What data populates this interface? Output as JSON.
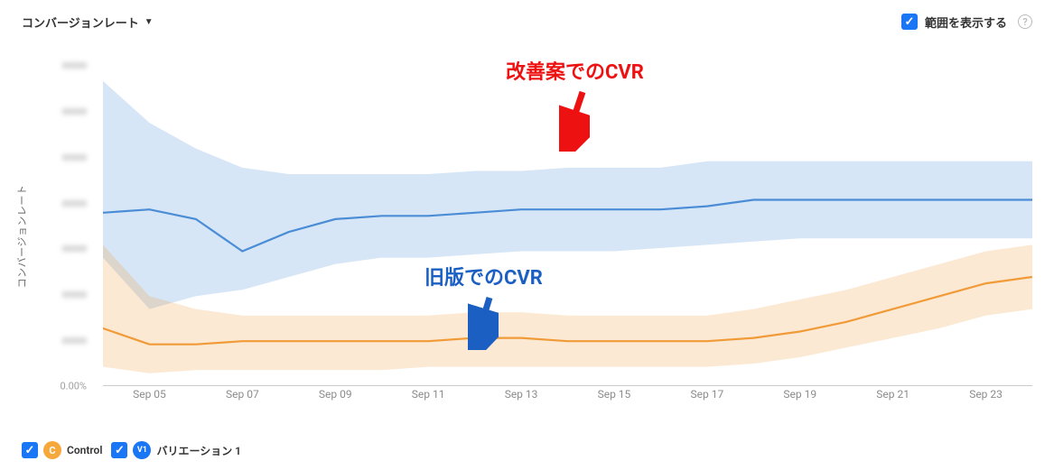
{
  "header": {
    "dropdown_label": "コンバージョンレート",
    "range_toggle_label": "範囲を表示する"
  },
  "y_axis": {
    "label": "コンバージョンレート",
    "ticks": [
      "xxxxx",
      "xxxxx",
      "xxxxx",
      "xxxxx",
      "xxxxx",
      "xxxxx",
      "xxxxx",
      "0.00%"
    ]
  },
  "x_axis": {
    "labels": [
      "Sep 05",
      "Sep 07",
      "Sep 09",
      "Sep 11",
      "Sep 13",
      "Sep 15",
      "Sep 17",
      "Sep 19",
      "Sep 21",
      "Sep 23"
    ]
  },
  "legend": {
    "control_badge": "C",
    "control_label": "Control",
    "variation_badge": "V1",
    "variation_label": "バリエーション 1"
  },
  "annotations": {
    "red_label": "改善案でのCVR",
    "blue_label": "旧版でのCVR"
  },
  "chart_data": {
    "type": "line",
    "title": "コンバージョンレート",
    "xlabel": "",
    "ylabel": "コンバージョンレート",
    "ylim": [
      0,
      100
    ],
    "x": [
      "Sep 04",
      "Sep 05",
      "Sep 06",
      "Sep 07",
      "Sep 08",
      "Sep 09",
      "Sep 10",
      "Sep 11",
      "Sep 12",
      "Sep 13",
      "Sep 14",
      "Sep 15",
      "Sep 16",
      "Sep 17",
      "Sep 18",
      "Sep 19",
      "Sep 20",
      "Sep 21",
      "Sep 22",
      "Sep 23",
      "Sep 24"
    ],
    "series": [
      {
        "name": "バリエーション 1",
        "color": "#4a8dd6",
        "values": [
          54,
          55,
          52,
          42,
          48,
          52,
          53,
          53,
          54,
          55,
          55,
          55,
          55,
          56,
          58,
          58,
          58,
          58,
          58,
          58,
          58
        ],
        "lower": [
          40,
          24,
          28,
          30,
          34,
          38,
          40,
          40,
          41,
          42,
          42,
          42,
          43,
          44,
          45,
          46,
          46,
          46,
          46,
          46,
          46
        ],
        "upper": [
          95,
          82,
          74,
          68,
          66,
          66,
          66,
          66,
          67,
          67,
          68,
          68,
          68,
          70,
          70,
          70,
          70,
          70,
          70,
          70,
          70
        ]
      },
      {
        "name": "Control",
        "color": "#f19b38",
        "values": [
          18,
          13,
          13,
          14,
          14,
          14,
          14,
          14,
          15,
          15,
          14,
          14,
          14,
          14,
          15,
          17,
          20,
          24,
          28,
          32,
          34
        ],
        "lower": [
          6,
          4,
          5,
          5,
          5,
          5,
          5,
          6,
          6,
          6,
          6,
          6,
          6,
          6,
          7,
          9,
          12,
          15,
          18,
          22,
          24
        ],
        "upper": [
          44,
          28,
          24,
          22,
          22,
          22,
          22,
          22,
          23,
          23,
          22,
          22,
          22,
          22,
          24,
          27,
          30,
          34,
          38,
          42,
          44
        ]
      }
    ],
    "annotations": [
      {
        "text": "改善案でのCVR",
        "series": "バリエーション 1",
        "color": "#e11"
      },
      {
        "text": "旧版でのCVR",
        "series": "Control",
        "color": "#1b5fc2"
      }
    ]
  }
}
